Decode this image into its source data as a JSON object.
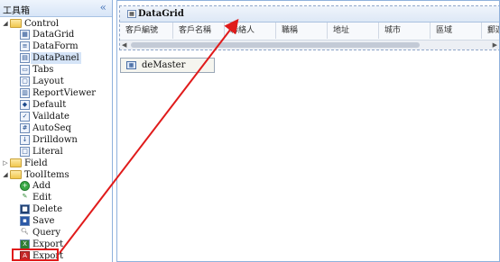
{
  "toolbox": {
    "title": "工具箱",
    "collapse_icon": "double-chevron-left-icon",
    "groups": [
      {
        "label": "Control",
        "items": [
          "DataGrid",
          "DataForm",
          "DataPanel",
          "Tabs",
          "Layout",
          "ReportViewer",
          "Default",
          "Vaildate",
          "AutoSeq",
          "Drilldown",
          "Literal"
        ]
      },
      {
        "label": "Field",
        "items": []
      },
      {
        "label": "ToolItems",
        "items": [
          "Add",
          "Edit",
          "Delete",
          "Save",
          "Query",
          "Export",
          "Export"
        ]
      }
    ]
  },
  "designer": {
    "grid": {
      "title": "DataGrid",
      "columns": [
        "客戶編號",
        "客戶名稱",
        "聯絡人",
        "職稱",
        "地址",
        "城市",
        "區域",
        "郵遞"
      ]
    },
    "datasource": {
      "label": "deMaster"
    }
  },
  "annotation": {
    "highlight_color": "#e01b1b"
  }
}
